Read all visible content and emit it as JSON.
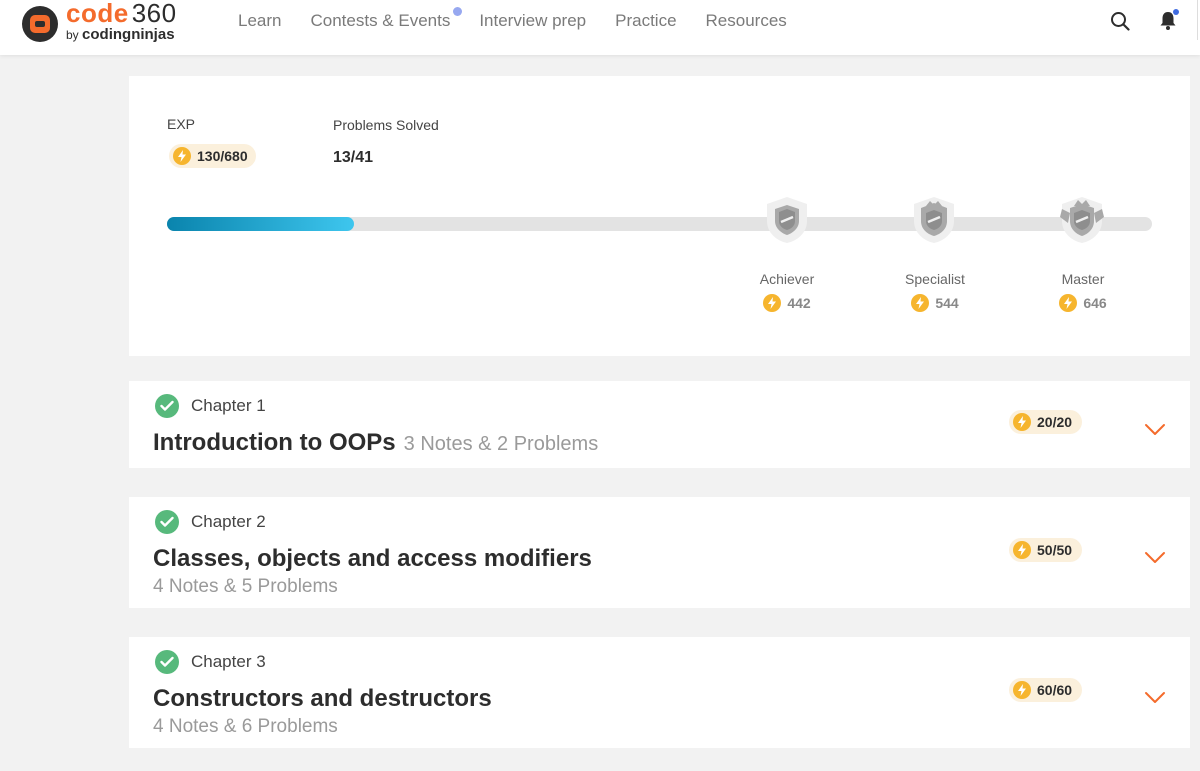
{
  "brand": {
    "word": "code",
    "number": "360",
    "by": "by",
    "company": "codingninjas",
    "accent": "#f46b2c"
  },
  "nav": [
    {
      "label": "Learn"
    },
    {
      "label": "Contests & Events",
      "has_dot": true
    },
    {
      "label": "Interview prep"
    },
    {
      "label": "Practice"
    },
    {
      "label": "Resources"
    }
  ],
  "icons": {
    "search": "search-icon",
    "notifications": "bell-icon"
  },
  "progress": {
    "exp_label": "EXP",
    "exp_value": "130/680",
    "problems_label": "Problems Solved",
    "problems_value": "13/41",
    "fill_fraction": 0.19,
    "bar_color": "#1aa6d6",
    "milestones": [
      {
        "name": "Achiever",
        "exp": "442"
      },
      {
        "name": "Specialist",
        "exp": "544"
      },
      {
        "name": "Master",
        "exp": "646"
      }
    ]
  },
  "chapters": [
    {
      "number": "Chapter 1",
      "title": "Introduction to OOPs",
      "meta": "3 Notes & 2 Problems",
      "exp": "20/20",
      "completed": true
    },
    {
      "number": "Chapter 2",
      "title": "Classes, objects and access modifiers",
      "meta": "4 Notes & 5 Problems",
      "exp": "50/50",
      "completed": true
    },
    {
      "number": "Chapter 3",
      "title": "Constructors and destructors",
      "meta": "4 Notes & 6 Problems",
      "exp": "60/60",
      "completed": true
    }
  ],
  "colors": {
    "complete": "#57b97c",
    "exp_badge": "#f6b52e",
    "chevron": "#f46b2c"
  }
}
